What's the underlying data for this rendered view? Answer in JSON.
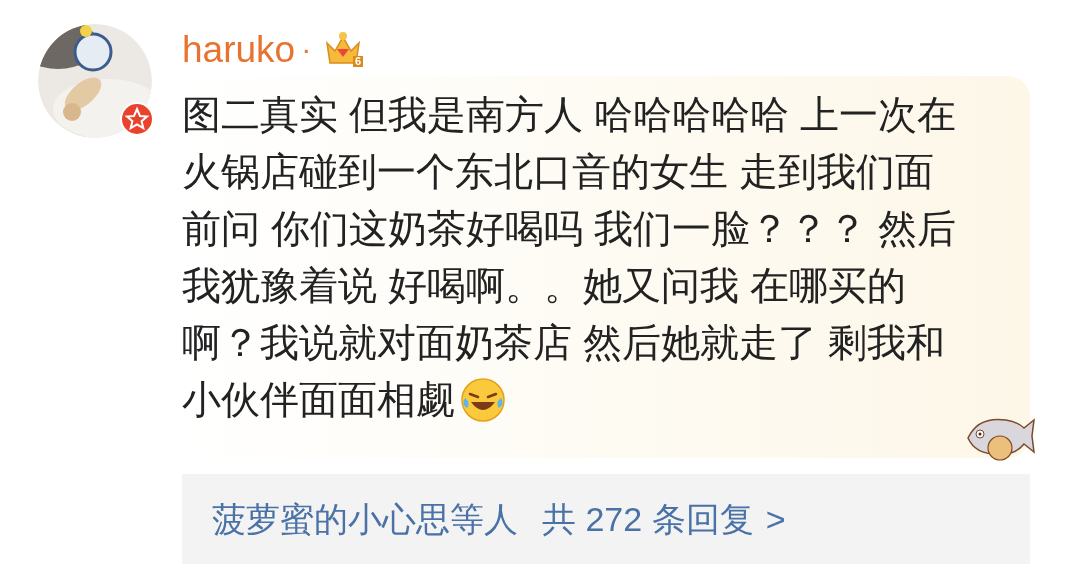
{
  "comment": {
    "username": "haruko",
    "separator": "·",
    "level_badge": "6",
    "lines": [
      "图二真实 但我是南方人 哈哈哈哈哈 上一次在",
      "火锅店碰到一个东北口音的女生 走到我们面",
      "前问 你们这奶茶好喝吗 我们一脸？？？ 然后",
      "我犹豫着说 好喝啊。。她又问我 在哪买的",
      "啊？我说就对面奶茶店 然后她就走了 剩我和",
      "小伙伴面面相觑"
    ]
  },
  "replies": {
    "names": "菠萝蜜的小心思等人",
    "count": "共 272 条回复",
    "arrow": ">"
  }
}
